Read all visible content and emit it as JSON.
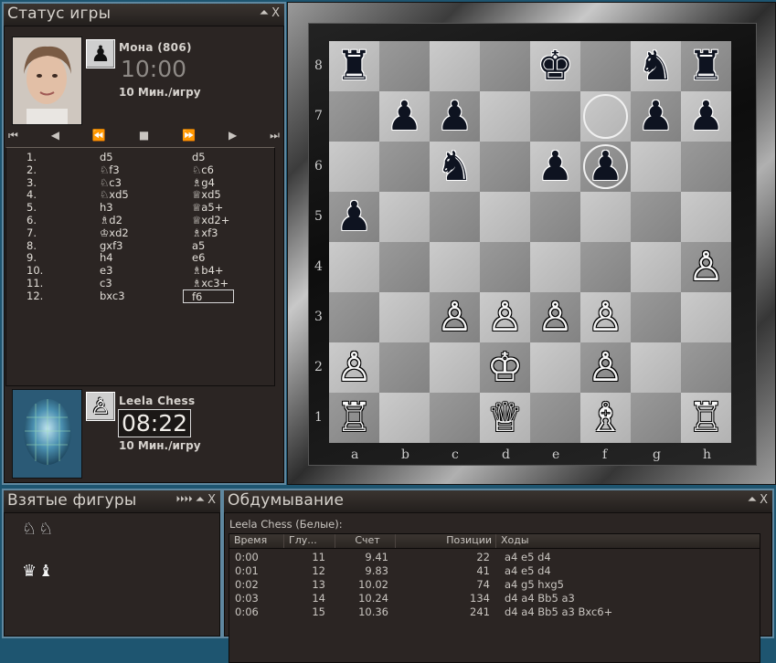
{
  "status_panel": {
    "title": "Статус игры",
    "buttons": [
      "⏶",
      "X"
    ],
    "black_player": {
      "name": "Мона (806)",
      "clock": "10:00",
      "time_control": "10 Мин./игру",
      "piece_icon": "black-pawn-icon"
    },
    "white_player": {
      "name": "Leela Chess",
      "clock": "08:22",
      "time_control": "10 Мин./игру",
      "piece_icon": "white-pawn-icon"
    },
    "nav": [
      "⏮",
      "◀",
      "⏪",
      "■",
      "⏩",
      "▶",
      "⏭"
    ],
    "moves": [
      {
        "num": "1.",
        "white": "d5",
        "black": "d5"
      },
      {
        "num": "2.",
        "white": "♘f3",
        "black": "♘c6"
      },
      {
        "num": "3.",
        "white": "♘c3",
        "black": "♗g4"
      },
      {
        "num": "4.",
        "white": "♘xd5",
        "black": "♕xd5"
      },
      {
        "num": "5.",
        "white": "h3",
        "black": "♕a5+"
      },
      {
        "num": "6.",
        "white": "♗d2",
        "black": "♕xd2+"
      },
      {
        "num": "7.",
        "white": "♔xd2",
        "black": "♗xf3"
      },
      {
        "num": "8.",
        "white": "gxf3",
        "black": "a5"
      },
      {
        "num": "9.",
        "white": "h4",
        "black": "e6"
      },
      {
        "num": "10.",
        "white": "e3",
        "black": "♗b4+"
      },
      {
        "num": "11.",
        "white": "c3",
        "black": "♗xc3+"
      },
      {
        "num": "12.",
        "white": "bxc3",
        "black": "f6"
      }
    ]
  },
  "board": {
    "files": [
      "a",
      "b",
      "c",
      "d",
      "e",
      "f",
      "g",
      "h"
    ],
    "ranks": [
      "8",
      "7",
      "6",
      "5",
      "4",
      "3",
      "2",
      "1"
    ],
    "pieces": [
      {
        "sq": "a8",
        "p": "♜",
        "c": "b"
      },
      {
        "sq": "e8",
        "p": "♚",
        "c": "b"
      },
      {
        "sq": "g8",
        "p": "♞",
        "c": "b"
      },
      {
        "sq": "h8",
        "p": "♜",
        "c": "b"
      },
      {
        "sq": "b7",
        "p": "♟",
        "c": "b"
      },
      {
        "sq": "c7",
        "p": "♟",
        "c": "b"
      },
      {
        "sq": "g7",
        "p": "♟",
        "c": "b"
      },
      {
        "sq": "h7",
        "p": "♟",
        "c": "b"
      },
      {
        "sq": "c6",
        "p": "♞",
        "c": "b"
      },
      {
        "sq": "e6",
        "p": "♟",
        "c": "b"
      },
      {
        "sq": "f6",
        "p": "♟",
        "c": "b"
      },
      {
        "sq": "a5",
        "p": "♟",
        "c": "b"
      },
      {
        "sq": "h4",
        "p": "♙",
        "c": "w"
      },
      {
        "sq": "c3",
        "p": "♙",
        "c": "w"
      },
      {
        "sq": "d3",
        "p": "♙",
        "c": "w"
      },
      {
        "sq": "e3",
        "p": "♙",
        "c": "w"
      },
      {
        "sq": "f3",
        "p": "♙",
        "c": "w"
      },
      {
        "sq": "a2",
        "p": "♙",
        "c": "w"
      },
      {
        "sq": "d2",
        "p": "♔",
        "c": "w"
      },
      {
        "sq": "f2",
        "p": "♙",
        "c": "w"
      },
      {
        "sq": "a1",
        "p": "♖",
        "c": "w"
      },
      {
        "sq": "d1",
        "p": "♕",
        "c": "w"
      },
      {
        "sq": "f1",
        "p": "♗",
        "c": "w"
      },
      {
        "sq": "h1",
        "p": "♖",
        "c": "w"
      }
    ],
    "last_move_from": "f7",
    "last_move_to": "f6"
  },
  "captured_panel": {
    "title": "Взятые фигуры",
    "buttons": [
      "⏵⏵⏵⏵",
      "⏶",
      "X"
    ],
    "white_row": "♘♘",
    "black_row": "♛♝"
  },
  "analysis_panel": {
    "title": "Обдумывание",
    "buttons": [
      "⏶",
      "X"
    ],
    "engine": "Leela Chess (Белые):",
    "columns": [
      "Время",
      "Глу...",
      "Счет",
      "Позиции",
      "Ходы"
    ],
    "rows": [
      {
        "time": "0:00",
        "depth": "11",
        "score": "9.41",
        "nodes": "22",
        "line": "a4 e5 d4"
      },
      {
        "time": "0:01",
        "depth": "12",
        "score": "9.83",
        "nodes": "41",
        "line": "a4 e5 d4"
      },
      {
        "time": "0:02",
        "depth": "13",
        "score": "10.02",
        "nodes": "74",
        "line": "a4 g5 hxg5"
      },
      {
        "time": "0:03",
        "depth": "14",
        "score": "10.24",
        "nodes": "134",
        "line": "d4 a4 Bb5 a3"
      },
      {
        "time": "0:06",
        "depth": "15",
        "score": "10.36",
        "nodes": "241",
        "line": "d4 a4 Bb5 a3 Bxc6+"
      }
    ]
  },
  "colors": {
    "background": "#1e5570",
    "panel": "#2b2523",
    "panel_border": "#5f88a0",
    "light_square": "#bfbfbf",
    "dark_square": "#8e8e8e"
  }
}
